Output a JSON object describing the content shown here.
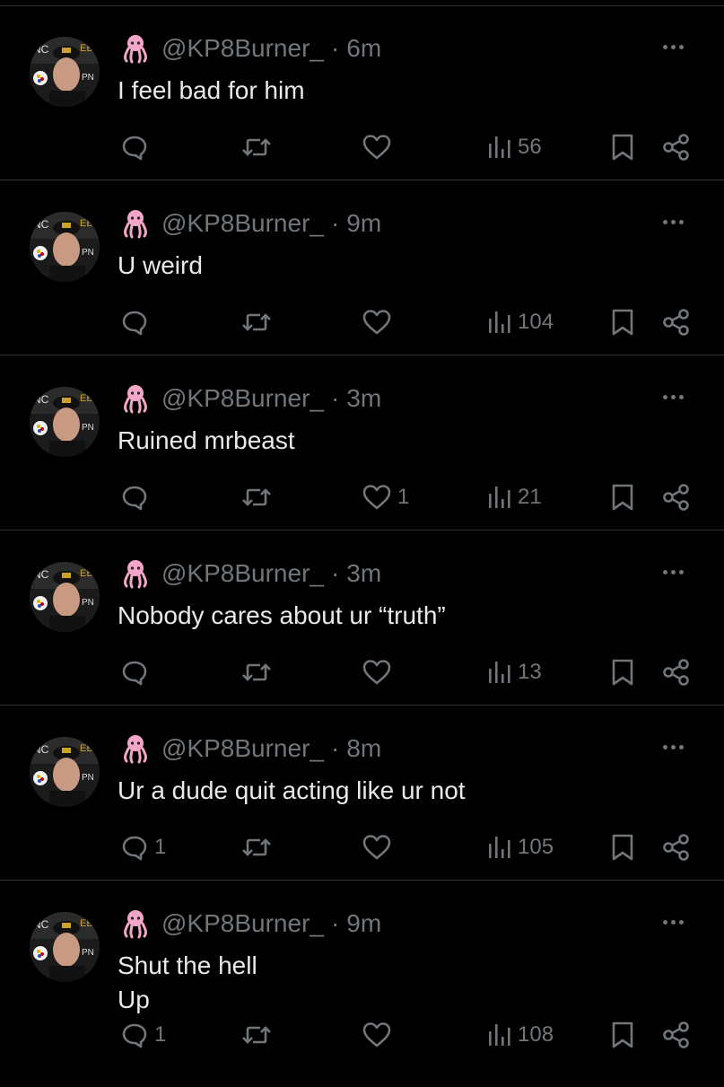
{
  "feed": {
    "tweets": [
      {
        "handle": "@KP8Burner_",
        "sep": "·",
        "time": "6m",
        "text": "I feel bad for him",
        "replies": "",
        "likes": "",
        "views": "56"
      },
      {
        "handle": "@KP8Burner_",
        "sep": "·",
        "time": "9m",
        "text": "U weird",
        "replies": "",
        "likes": "",
        "views": "104"
      },
      {
        "handle": "@KP8Burner_",
        "sep": "·",
        "time": "3m",
        "text": "Ruined mrbeast",
        "replies": "",
        "likes": "1",
        "views": "21"
      },
      {
        "handle": "@KP8Burner_",
        "sep": "·",
        "time": "3m",
        "text": "Nobody cares about ur “truth”",
        "replies": "",
        "likes": "",
        "views": "13"
      },
      {
        "handle": "@KP8Burner_",
        "sep": "·",
        "time": "8m",
        "text": "Ur a dude quit acting like ur not",
        "replies": "1",
        "likes": "",
        "views": "105"
      },
      {
        "handle": "@KP8Burner_",
        "sep": "·",
        "time": "9m",
        "text": "Shut the hell\nUp",
        "replies": "1",
        "likes": "",
        "views": "108"
      }
    ]
  },
  "icons": {
    "avatar_badge": "octopus-icon",
    "reply": "reply-icon",
    "retweet": "retweet-icon",
    "like": "heart-icon",
    "views": "views-icon",
    "bookmark": "bookmark-icon",
    "share": "share-icon",
    "more": "more-icon"
  },
  "colors": {
    "background": "#000000",
    "text": "#e7e9ea",
    "muted": "#71767b",
    "divider": "#2f3336",
    "octopus": "#f4a6c8"
  }
}
